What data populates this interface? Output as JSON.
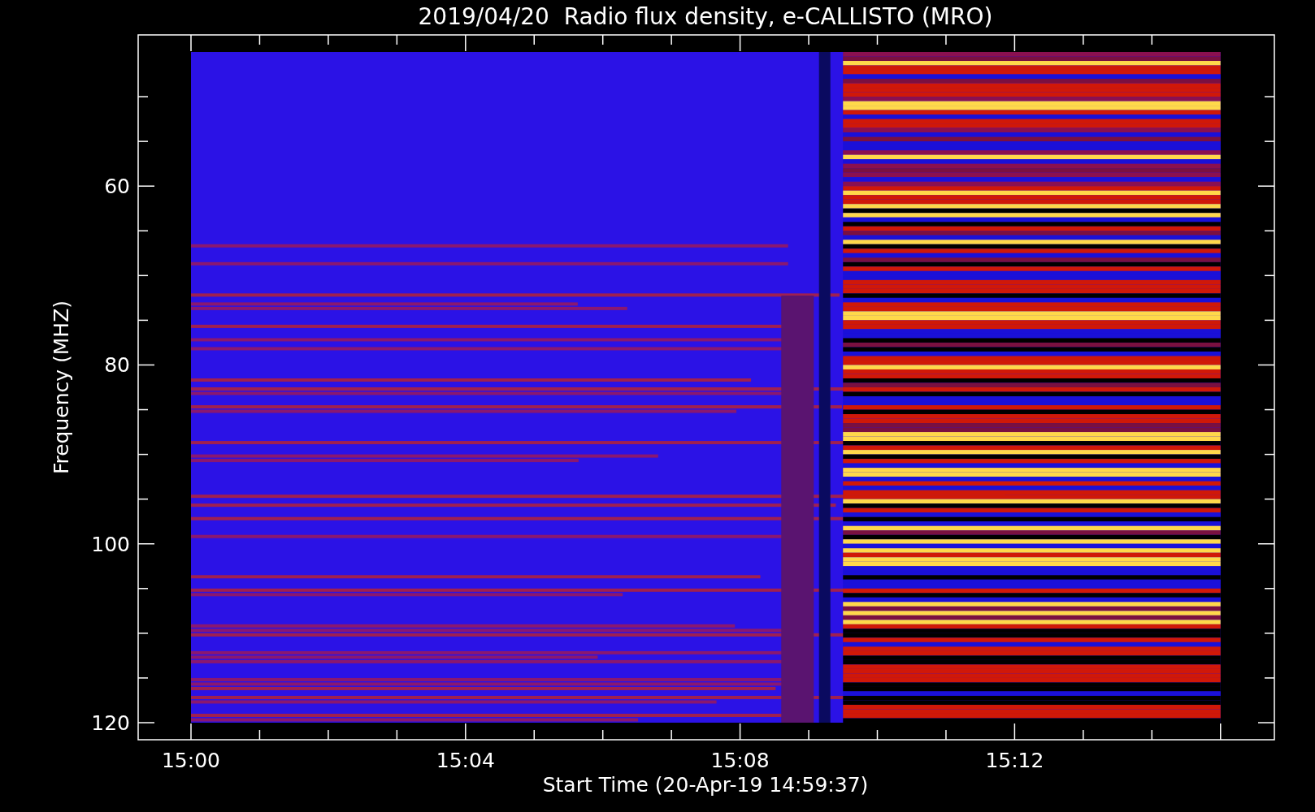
{
  "title": "2019/04/20  Radio flux density, e-CALLISTO (MRO)",
  "y_axis": {
    "label": "Frequency (MHZ)",
    "ticks": [
      "60",
      "80",
      "100",
      "120"
    ]
  },
  "x_axis": {
    "label": "Start Time (20-Apr-19 14:59:37)",
    "ticks": [
      "15:00",
      "15:04",
      "15:08",
      "15:12"
    ]
  }
}
